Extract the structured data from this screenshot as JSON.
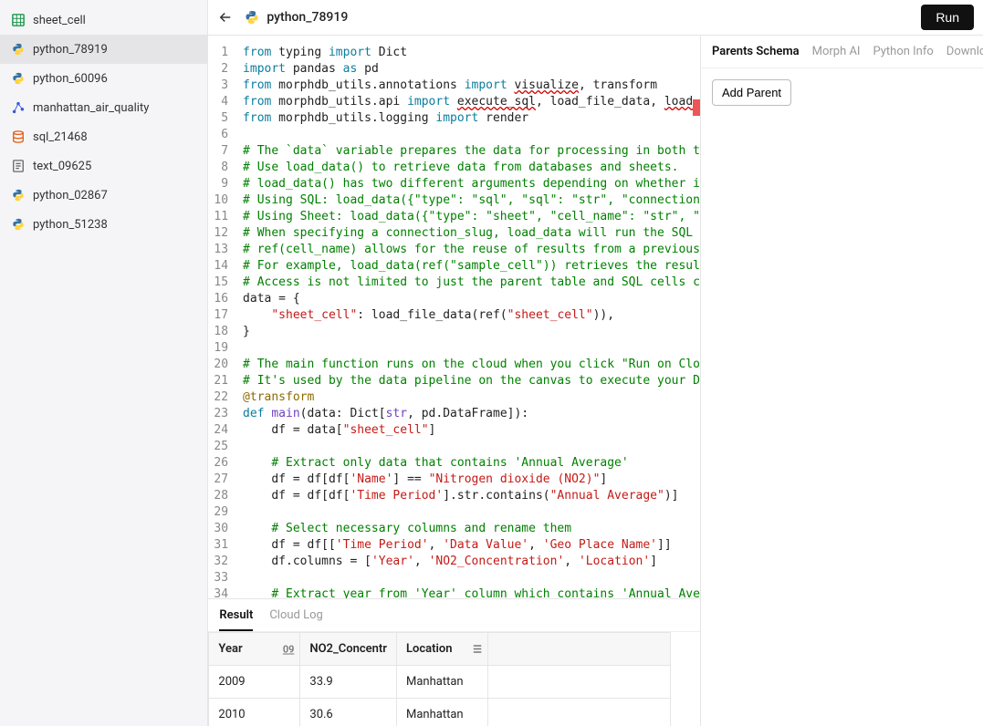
{
  "sidebar": {
    "items": [
      {
        "label": "sheet_cell",
        "icon": "grid",
        "color": "#0a8f3c"
      },
      {
        "label": "python_78919",
        "icon": "python",
        "color": "#3572A5",
        "active": true
      },
      {
        "label": "python_60096",
        "icon": "python",
        "color": "#3572A5"
      },
      {
        "label": "manhattan_air_quality",
        "icon": "graph",
        "color": "#3b5bdb"
      },
      {
        "label": "sql_21468",
        "icon": "db",
        "color": "#e8590c"
      },
      {
        "label": "text_09625",
        "icon": "text",
        "color": "#666"
      },
      {
        "label": "python_02867",
        "icon": "python",
        "color": "#3572A5"
      },
      {
        "label": "python_51238",
        "icon": "python",
        "color": "#3572A5"
      }
    ]
  },
  "header": {
    "title": "python_78919",
    "run_label": "Run"
  },
  "code_lines": [
    {
      "n": 1,
      "html": "<span class='kw'>from</span> typing <span class='kw'>import</span> Dict"
    },
    {
      "n": 2,
      "html": "<span class='kw'>import</span> pandas <span class='as'>as</span> pd"
    },
    {
      "n": 3,
      "html": "<span class='kw'>from</span> morphdb_utils.annotations <span class='kw'>import</span> <span class='err'>visualize</span>, transform"
    },
    {
      "n": 4,
      "html": "<span class='kw'>from</span> morphdb_utils.api <span class='kw'>import</span> <span class='err'>execute_sql</span>, load_file_data, <span class='err'>load_</span>"
    },
    {
      "n": 5,
      "html": "<span class='kw'>from</span> morphdb_utils.logging <span class='kw'>import</span> render"
    },
    {
      "n": 6,
      "html": ""
    },
    {
      "n": 7,
      "html": "<span class='cmt'># The `data` variable prepares the data for processing in both t</span>"
    },
    {
      "n": 8,
      "html": "<span class='cmt'># Use load_data() to retrieve data from databases and sheets.</span>"
    },
    {
      "n": 9,
      "html": "<span class='cmt'># load_data() has two different arguments depending on whether i</span>"
    },
    {
      "n": 10,
      "html": "<span class='cmt'># Using SQL: load_data({\"type\": \"sql\", \"sql\": \"str\", \"connection</span>"
    },
    {
      "n": 11,
      "html": "<span class='cmt'># Using Sheet: load_data({\"type\": \"sheet\", \"cell_name\": \"str\", \"</span>"
    },
    {
      "n": 12,
      "html": "<span class='cmt'># When specifying a connection_slug, load_data will run the SQL </span>"
    },
    {
      "n": 13,
      "html": "<span class='cmt'># ref(cell_name) allows for the reuse of results from a previous</span>"
    },
    {
      "n": 14,
      "html": "<span class='cmt'># For example, load_data(ref(\"sample_cell\")) retrieves the resul</span>"
    },
    {
      "n": 15,
      "html": "<span class='cmt'># Access is not limited to just the parent table and SQL cells c</span>"
    },
    {
      "n": 16,
      "html": "data = {"
    },
    {
      "n": 17,
      "html": "    <span class='str'>\"sheet_cell\"</span>: load_file_data(ref(<span class='str'>\"sheet_cell\"</span>)),"
    },
    {
      "n": 18,
      "html": "}"
    },
    {
      "n": 19,
      "html": ""
    },
    {
      "n": 20,
      "html": "<span class='cmt'># The main function runs on the cloud when you click \"Run on Clo</span>"
    },
    {
      "n": 21,
      "html": "<span class='cmt'># It's used by the data pipeline on the canvas to execute your D</span>"
    },
    {
      "n": 22,
      "html": "<span class='dec'>@transform</span>"
    },
    {
      "n": 23,
      "html": "<span class='kw'>def</span> <span class='fn'>main</span>(data: Dict[<span class='fn'>str</span>, pd.DataFrame]):"
    },
    {
      "n": 24,
      "html": "    df = data[<span class='str'>\"sheet_cell\"</span>]"
    },
    {
      "n": 25,
      "html": ""
    },
    {
      "n": 26,
      "html": "    <span class='cmt'># Extract only data that contains 'Annual Average'</span>"
    },
    {
      "n": 27,
      "html": "    df = df[df[<span class='str'>'Name'</span>] == <span class='str'>\"Nitrogen dioxide (NO2)\"</span>]"
    },
    {
      "n": 28,
      "html": "    df = df[df[<span class='str'>'Time Period'</span>].str.contains(<span class='str'>\"Annual Average\"</span>)]"
    },
    {
      "n": 29,
      "html": ""
    },
    {
      "n": 30,
      "html": "    <span class='cmt'># Select necessary columns and rename them</span>"
    },
    {
      "n": 31,
      "html": "    df = df[[<span class='str'>'Time Period'</span>, <span class='str'>'Data Value'</span>, <span class='str'>'Geo Place Name'</span>]]"
    },
    {
      "n": 32,
      "html": "    df.columns = [<span class='str'>'Year'</span>, <span class='str'>'NO2_Concentration'</span>, <span class='str'>'Location'</span>]"
    },
    {
      "n": 33,
      "html": ""
    },
    {
      "n": 34,
      "html": "    <span class='cmt'># Extract year from 'Year' column which contains 'Annual Ave</span>"
    }
  ],
  "result": {
    "tabs": [
      {
        "label": "Result",
        "active": true
      },
      {
        "label": "Cloud Log"
      }
    ],
    "columns": [
      {
        "name": "Year",
        "icon": "09"
      },
      {
        "name": "NO2_Concentr",
        "icon": ""
      },
      {
        "name": "Location",
        "icon": "menu"
      }
    ],
    "rows": [
      [
        "2009",
        "33.9",
        "Manhattan"
      ],
      [
        "2010",
        "30.6",
        "Manhattan"
      ]
    ]
  },
  "right": {
    "tabs": [
      {
        "label": "Parents Schema",
        "active": true
      },
      {
        "label": "Morph AI"
      },
      {
        "label": "Python Info"
      },
      {
        "label": "Download"
      }
    ],
    "add_parent_label": "Add Parent"
  }
}
